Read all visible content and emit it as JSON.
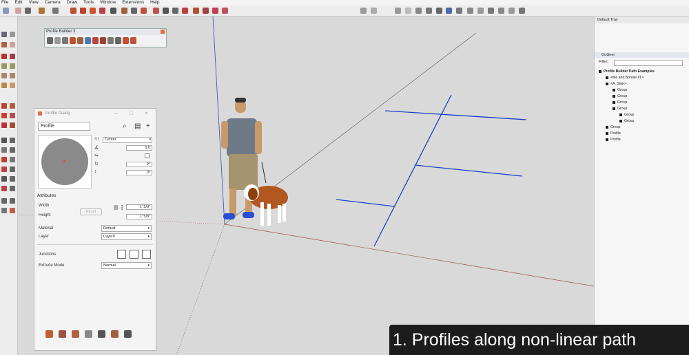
{
  "menu": [
    "File",
    "Edit",
    "View",
    "Camera",
    "Draw",
    "Tools",
    "Window",
    "Extensions",
    "Help"
  ],
  "pb_toolbar": {
    "title": "Profile Builder 3"
  },
  "dialog": {
    "title": "Profile Dialog",
    "profile_name": "Profile",
    "align_value": "Center",
    "offset": "0.0",
    "rot1": "0°",
    "rot2": "0°",
    "attributes_label": "Attributes",
    "width_label": "Width",
    "width_value": "1' 5/8\"",
    "height_label": "Height",
    "height_value": "1' 5/8\"",
    "reset_label": "Reset",
    "material_label": "Material",
    "material_value": "Default",
    "layer_label": "Layer",
    "layer_value": "Layer0",
    "junctions_label": "Junctions",
    "extrude_label": "Extrude Mode",
    "extrude_value": "Normal"
  },
  "tray": {
    "title": "Default Tray",
    "outliner_title": "Outliner",
    "filter_label": "Filter:",
    "tree": [
      {
        "label": "Profile Builder Path Examples",
        "bold": true
      },
      {
        "label": "<Me and Bonnie #1>"
      },
      {
        "label": "<A_Stair>"
      },
      {
        "label": "Group"
      },
      {
        "label": "Group"
      },
      {
        "label": "Group"
      },
      {
        "label": "Group"
      },
      {
        "label": "Group"
      },
      {
        "label": "Group"
      },
      {
        "label": "Group"
      },
      {
        "label": "Profile"
      },
      {
        "label": "Profile"
      }
    ]
  },
  "caption": "1. Profiles along non-linear path",
  "colors": {
    "path_blue": "#1a3fc8",
    "axis_green": "#3c8a3c",
    "axis_red": "#a05040",
    "axis_blue": "#3a4ab0"
  }
}
